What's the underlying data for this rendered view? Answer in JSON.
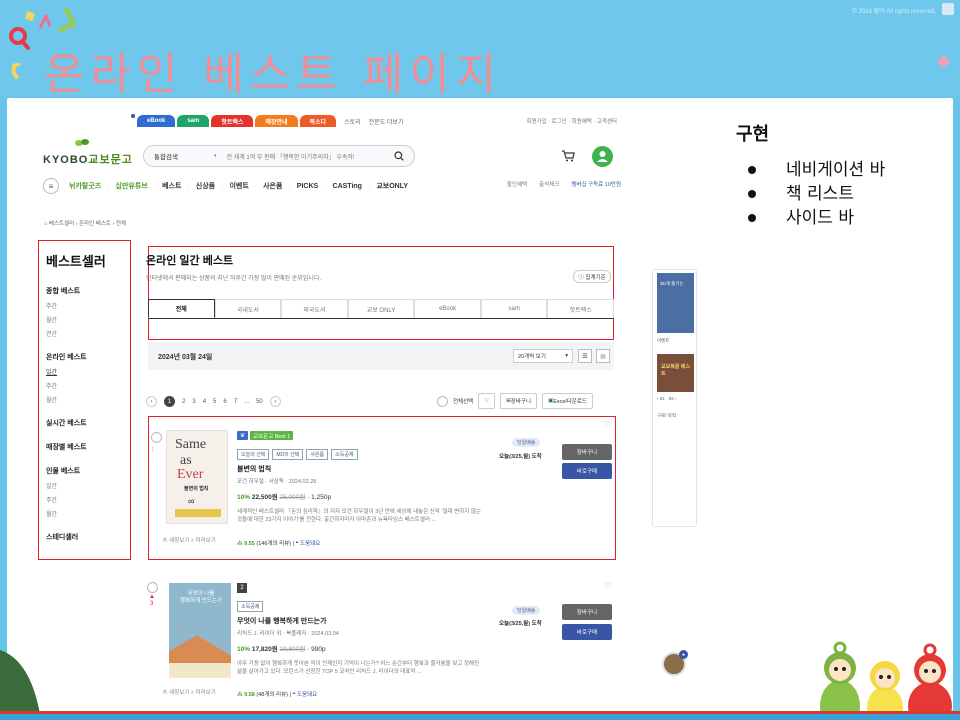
{
  "slide": {
    "title": "온라인 베스트 페이지",
    "copyright": "© 2016 황바 All rights reserved."
  },
  "notes": {
    "title": "구현",
    "items": [
      "네비게이션 바",
      "책 리스트",
      "사이드 바"
    ]
  },
  "site": {
    "top_tabs": [
      {
        "label": "eBook",
        "color": "#2f6bd0"
      },
      {
        "label": "sam",
        "color": "#1fa56b"
      },
      {
        "label": "핫트랙스",
        "color": "#e2342b"
      },
      {
        "label": "매장안내",
        "color": "#f27c1f"
      },
      {
        "label": "북소다",
        "color": "#ee5a25"
      }
    ],
    "top_links": [
      "스토리",
      "전문도 더보기"
    ],
    "util_links": "회원가입 · 로그인 · 회원혜택 · 고객센터",
    "logo": "KYOBO",
    "logo_suffix": "교보문고",
    "search_category": "통합검색",
    "search_placeholder": "전 세계 1억 부 판매 「행복한 이기주의자」 우속작!",
    "nav_items": [
      {
        "label": "뉘카탈굿즈",
        "green": true
      },
      {
        "label": "십만유튜브",
        "green": true
      },
      {
        "label": "베스트",
        "green": false
      },
      {
        "label": "신상품",
        "green": false
      },
      {
        "label": "이벤트",
        "green": false
      },
      {
        "label": "사은품",
        "green": false
      },
      {
        "label": "PICKS",
        "green": false
      },
      {
        "label": "CASTing",
        "green": false
      },
      {
        "label": "교보ONLY",
        "green": false
      }
    ],
    "nav_right": [
      "할인혜택",
      "출석체크",
      "멤버십 구독료 10만원"
    ],
    "breadcrumb": "베스트셀러 › 온라인 베스트 › 전체"
  },
  "sidebar": {
    "title": "베스트셀러",
    "groups": [
      {
        "label": "종합 베스트",
        "subs": [
          {
            "label": "주간",
            "active": false
          },
          {
            "label": "월간",
            "active": false
          },
          {
            "label": "연간",
            "active": false
          }
        ]
      },
      {
        "label": "온라인 베스트",
        "subs": [
          {
            "label": "일간",
            "active": true
          },
          {
            "label": "주간",
            "active": false
          },
          {
            "label": "월간",
            "active": false
          }
        ]
      },
      {
        "label": "실시간 베스트",
        "subs": []
      },
      {
        "label": "매장별 베스트",
        "subs": []
      },
      {
        "label": "인물 베스트",
        "subs": [
          {
            "label": "일간",
            "active": false
          },
          {
            "label": "주간",
            "active": false
          },
          {
            "label": "월간",
            "active": false
          }
        ]
      },
      {
        "label": "스테디셀러",
        "subs": []
      }
    ]
  },
  "main": {
    "title": "온라인 일간 베스트",
    "desc": "인터넷에서 판매되는 상품의 지난 하루간 가장 많이 판매된 순위입니다.",
    "info_btn": "ⓘ 집계기준",
    "tabs": [
      {
        "label": "전체",
        "active": true
      },
      {
        "label": "국내도서",
        "active": false
      },
      {
        "label": "외국도서",
        "active": false
      },
      {
        "label": "교보 ONLY",
        "active": false
      },
      {
        "label": "eBook",
        "active": false
      },
      {
        "label": "sam",
        "active": false
      },
      {
        "label": "핫트랙스",
        "active": false
      }
    ],
    "date": "2024년 03월 24일",
    "per_page": "20개씩 보기",
    "pages": [
      "2",
      "3",
      "4",
      "5",
      "6",
      "7",
      "...",
      "50"
    ],
    "current_page": "1",
    "select_all": "전체선택",
    "cart_label": "장바구니",
    "excel_label": "Excel다운로드"
  },
  "books": [
    {
      "rank": "1",
      "badge": "교보문고 Best 1",
      "tags": [
        "오늘의 선택",
        "MD의 선택",
        "사은품",
        "소득공제"
      ],
      "title": "불변의 법칙",
      "meta": "모건 하우절 · 서삼독 · 2024.02.28",
      "discount": "10%",
      "price": "22,500원",
      "orig_price": "25,000원",
      "point": "1,250p",
      "desc": "세계적인 베스트셀러 『돈의 심리학』의 저자 모건 하우절이 3년 만에 세상에 내놓은 신작 '절대 변하지 않는 것들에 대한 23가지 이야기'를 전한다. 출간하자마자 아마존과 뉴욕타임스 베스트셀러 ...",
      "rating": "9.55",
      "reviews": "(146개의 리뷰)",
      "helpful": "도움돼요",
      "delivery_pill": "당일배송",
      "delivery": "오늘(3/25,월) 도착",
      "cart_btn": "장바구니",
      "buy_btn": "바로구매",
      "preview": "미리보기",
      "mark": "",
      "cover": [
        "Same",
        "as",
        "Ever",
        "불변의 법칙"
      ]
    },
    {
      "rank": "2",
      "tags": [
        "소득공제"
      ],
      "title": "무엇이 나를 행복하게 만드는가",
      "meta": "리처드 J. 라이더 외 · 북플레저 · 2024.03.04",
      "discount": "10%",
      "price": "17,820원",
      "orig_price": "19,800원",
      "point": "990p",
      "desc": "아무 거정 없이 행복하게 웃어본 적이 언제인지 기억이 나는가? 어느 순간부터 행복과 즐거움을 잊고 정해진 삶을 살아가고 있다. 모턴스가 선정한 TOP 5 코치인 리처드 J. 라이더의 대표작 ...",
      "rating": "9.58",
      "reviews": "(48개의 리뷰)",
      "helpful": "도움돼요",
      "delivery_pill": "당일배송",
      "delivery": "오늘(3/25,월) 도착",
      "cart_btn": "장바구니",
      "buy_btn": "바로구매",
      "preview": "미리보기",
      "mark": "3",
      "cover": [
        "무엇이 나를",
        "행복하게 만드는가"
      ]
    }
  ],
  "right_rail": {
    "item1": "3D게 즐기는",
    "label1": "이벤트",
    "item2": "교보북클 베스트",
    "pager": "01 · 02",
    "label2": "구로/ 북적"
  },
  "colors": {
    "accent_red": "#e0202a",
    "kyobo_green": "#4a9b26",
    "title_pink": "#f08e97",
    "cart_gray": "#666666",
    "buy_blue": "#3956a6"
  }
}
